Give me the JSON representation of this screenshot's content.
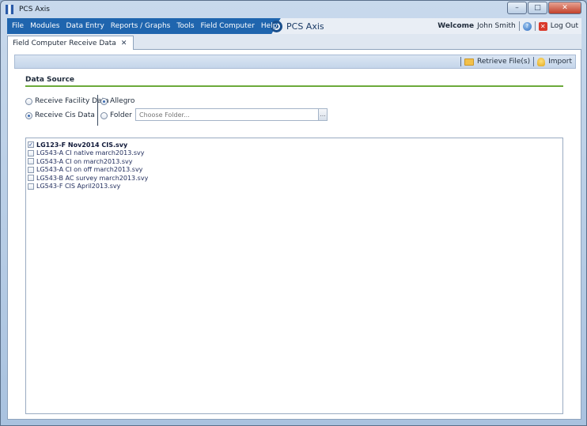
{
  "window": {
    "title": "PCS Axis",
    "minimize": "–",
    "maximize": "□",
    "close": "✕"
  },
  "menu": {
    "items": [
      "File",
      "Modules",
      "Data Entry",
      "Reports / Graphs",
      "Tools",
      "Field Computer",
      "Help"
    ],
    "brand": "PCS Axis",
    "welcome": "Welcome",
    "user": "John Smith",
    "help_glyph": "?",
    "logout": "Log Out"
  },
  "tab": {
    "label": "Field Computer Receive Data",
    "close": "✕"
  },
  "toolbar": {
    "retrieve": "Retrieve File(s)",
    "import": "Import"
  },
  "data_source": {
    "title": "Data Source",
    "type_options": [
      {
        "label": "Receive Facility Data",
        "selected": false
      },
      {
        "label": "Receive Cis Data",
        "selected": true
      }
    ],
    "source_options": [
      {
        "label": "Allegro",
        "selected": true
      },
      {
        "label": "Folder",
        "selected": false
      }
    ],
    "folder_placeholder": "Choose Folder...",
    "folder_dropdown": "…"
  },
  "files": [
    {
      "name": "LG123-F Nov2014 CIS.svy",
      "checked": true
    },
    {
      "name": "LG543-A CI native march2013.svy",
      "checked": false
    },
    {
      "name": "LG543-A CI on march2013.svy",
      "checked": false
    },
    {
      "name": "LG543-A CI on off march2013.svy",
      "checked": false
    },
    {
      "name": "LG543-B AC survey march2013.svy",
      "checked": false
    },
    {
      "name": "LG543-F CIS April2013.svy",
      "checked": false
    }
  ],
  "colors": {
    "menu_blue": "#1f65ae",
    "section_rule": "#6caa3a",
    "logout_red": "#d9382a"
  },
  "icons": {
    "retrieve": "folder-icon",
    "import": "import-icon",
    "help": "help-icon",
    "logout": "logout-icon",
    "brand": "pcs-logo-icon"
  }
}
